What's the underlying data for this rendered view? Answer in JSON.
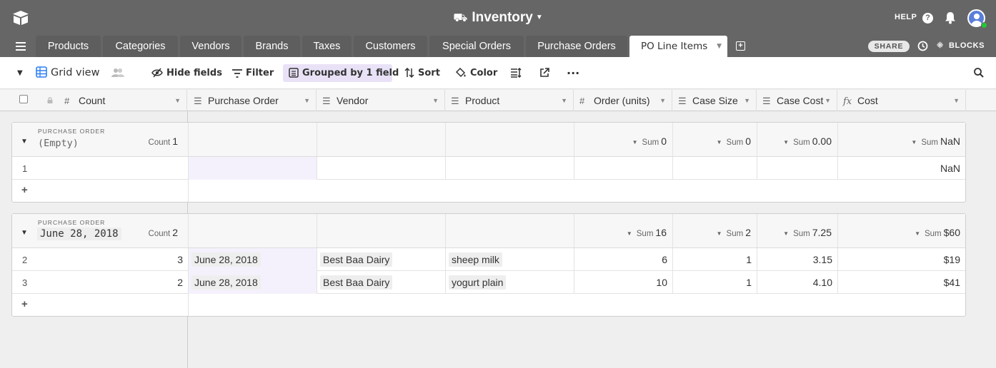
{
  "app": {
    "base_title": "Inventory",
    "help_label": "HELP",
    "share_label": "SHARE",
    "blocks_label": "BLOCKS"
  },
  "tabs": [
    "Products",
    "Categories",
    "Vendors",
    "Brands",
    "Taxes",
    "Customers",
    "Special Orders",
    "Purchase Orders",
    "PO Line Items"
  ],
  "active_tab": "PO Line Items",
  "toolbar": {
    "view_name": "Grid view",
    "hide_fields": "Hide fields",
    "filter": "Filter",
    "grouped": "Grouped by 1 field",
    "sort": "Sort",
    "color": "Color"
  },
  "columns": [
    "Count",
    "Purchase Order",
    "Vendor",
    "Product",
    "Order (units)",
    "Case Size",
    "Case Cost",
    "Cost"
  ],
  "groups": [
    {
      "label": "PURCHASE ORDER",
      "value": "(Empty)",
      "count_label": "Count",
      "count": "1",
      "sums": {
        "order_units": "0",
        "case_size": "0",
        "case_cost": "0.00",
        "cost": "NaN"
      },
      "sum_label": "Sum",
      "rows": [
        {
          "num": "1",
          "count": "",
          "po": "",
          "vendor": "",
          "product": "",
          "order_units": "",
          "case_size": "",
          "case_cost": "",
          "cost": "NaN"
        }
      ]
    },
    {
      "label": "PURCHASE ORDER",
      "value": "June 28, 2018",
      "count_label": "Count",
      "count": "2",
      "sums": {
        "order_units": "16",
        "case_size": "2",
        "case_cost": "7.25",
        "cost": "$60"
      },
      "sum_label": "Sum",
      "rows": [
        {
          "num": "2",
          "count": "3",
          "po": "June 28, 2018",
          "vendor": "Best Baa Dairy",
          "product": "sheep milk",
          "order_units": "6",
          "case_size": "1",
          "case_cost": "3.15",
          "cost": "$19"
        },
        {
          "num": "3",
          "count": "2",
          "po": "June 28, 2018",
          "vendor": "Best Baa Dairy",
          "product": "yogurt plain",
          "order_units": "10",
          "case_size": "1",
          "case_cost": "4.10",
          "cost": "$41"
        }
      ]
    }
  ],
  "add_row_symbol": "+"
}
